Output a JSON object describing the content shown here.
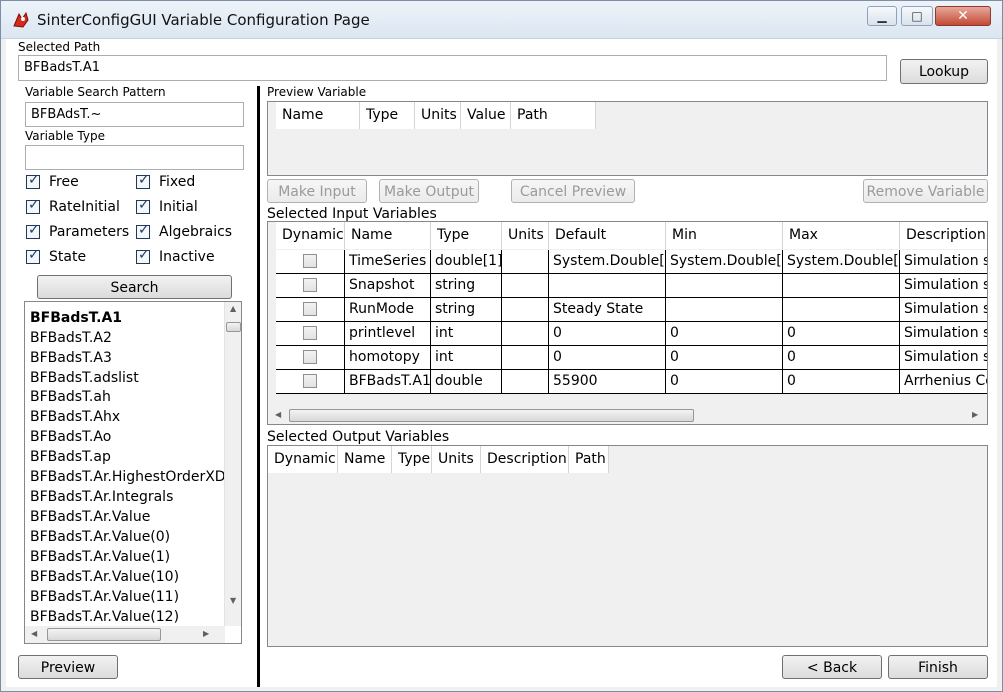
{
  "window": {
    "title": "SinterConfigGUI Variable Configuration Page",
    "min_icon": "minimize-icon",
    "max_icon": "maximize-icon",
    "close_icon": "close-icon"
  },
  "selected_path": {
    "label": "Selected Path",
    "value": "BFBadsT.A1"
  },
  "lookup_label": "Lookup",
  "search_pattern": {
    "label": "Variable Search Pattern",
    "value": "BFBAdsT.~"
  },
  "variable_type": {
    "label": "Variable Type",
    "value": ""
  },
  "checkboxes": [
    {
      "label": "Free",
      "checked": true
    },
    {
      "label": "Fixed",
      "checked": true
    },
    {
      "label": "RateInitial",
      "checked": true
    },
    {
      "label": "Initial",
      "checked": true
    },
    {
      "label": "Parameters",
      "checked": true
    },
    {
      "label": "Algebraics",
      "checked": true
    },
    {
      "label": "State",
      "checked": true
    },
    {
      "label": "Inactive",
      "checked": true
    }
  ],
  "search_label": "Search",
  "variables": [
    "BFBadsT.A1",
    "BFBadsT.A2",
    "BFBadsT.A3",
    "BFBadsT.adslist",
    "BFBadsT.ah",
    "BFBadsT.Ahx",
    "BFBadsT.Ao",
    "BFBadsT.ap",
    "BFBadsT.Ar.HighestOrderXDe",
    "BFBadsT.Ar.Integrals",
    "BFBadsT.Ar.Value",
    "BFBadsT.Ar.Value(0)",
    "BFBadsT.Ar.Value(1)",
    "BFBadsT.Ar.Value(10)",
    "BFBadsT.Ar.Value(11)",
    "BFBadsT.Ar.Value(12)"
  ],
  "preview_button": "Preview",
  "preview_variable": {
    "label": "Preview Variable",
    "columns": [
      "Name",
      "Type",
      "Units",
      "Value",
      "Path"
    ]
  },
  "actions": {
    "make_input": "Make Input",
    "make_output": "Make Output",
    "cancel_preview": "Cancel Preview",
    "remove_variable": "Remove Variable"
  },
  "input_vars": {
    "label": "Selected Input Variables",
    "columns": [
      "Dynamic",
      "Name",
      "Type",
      "Units",
      "Default",
      "Min",
      "Max",
      "Description"
    ],
    "rows": [
      {
        "dynamic": false,
        "name": "TimeSeries",
        "type": "double[1]",
        "units": "",
        "default": "System.Double[]",
        "min": "System.Double[]",
        "max": "System.Double[]",
        "description": "Simulation sp"
      },
      {
        "dynamic": false,
        "name": "Snapshot",
        "type": "string",
        "units": "",
        "default": "",
        "min": "",
        "max": "",
        "description": "Simulation sp"
      },
      {
        "dynamic": false,
        "name": "RunMode",
        "type": "string",
        "units": "",
        "default": "Steady State",
        "min": "",
        "max": "",
        "description": "Simulation sp"
      },
      {
        "dynamic": false,
        "name": "printlevel",
        "type": "int",
        "units": "",
        "default": "0",
        "min": "0",
        "max": "0",
        "description": "Simulation sp"
      },
      {
        "dynamic": false,
        "name": "homotopy",
        "type": "int",
        "units": "",
        "default": "0",
        "min": "0",
        "max": "0",
        "description": "Simulation sp"
      },
      {
        "dynamic": false,
        "name": "BFBadsT.A1",
        "type": "double",
        "units": "",
        "default": "55900",
        "min": "0",
        "max": "0",
        "description": "Arrhenius Co"
      }
    ]
  },
  "output_vars": {
    "label": "Selected Output Variables",
    "columns": [
      "Dynamic",
      "Name",
      "Type",
      "Units",
      "Description",
      "Path"
    ]
  },
  "nav": {
    "back": "< Back",
    "finish": "Finish"
  }
}
